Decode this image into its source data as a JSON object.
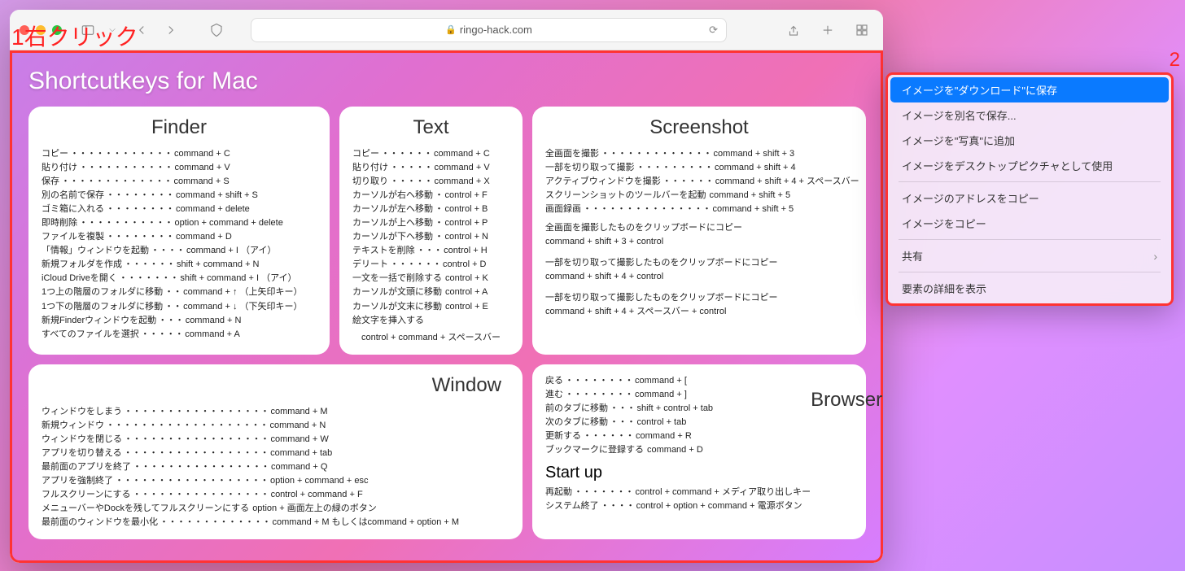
{
  "annotations": {
    "label1": "1右クリック",
    "label2": "2"
  },
  "browser": {
    "url_host": "ringo-hack.com"
  },
  "page": {
    "title": "Shortcutkeys for Mac"
  },
  "cards": {
    "finder": {
      "title": "Finder",
      "items": [
        {
          "label": "コピー",
          "dots": "・・・・・・・・・・・・",
          "key": "command + C"
        },
        {
          "label": "貼り付け",
          "dots": "・・・・・・・・・・・",
          "key": "command + V"
        },
        {
          "label": "保存",
          "dots": "・・・・・・・・・・・・・",
          "key": "command + S"
        },
        {
          "label": "別の名前で保存",
          "dots": "・・・・・・・・",
          "key": "command + shift + S"
        },
        {
          "label": "ゴミ箱に入れる",
          "dots": "・・・・・・・・",
          "key": "command + delete"
        },
        {
          "label": "即時削除",
          "dots": "・・・・・・・・・・・",
          "key": "option + command + delete"
        },
        {
          "label": "ファイルを複製",
          "dots": "・・・・・・・・",
          "key": "command + D"
        },
        {
          "label": "「情報」ウィンドウを起動",
          "dots": "・・・・",
          "key": "command + I （アイ）"
        },
        {
          "label": "新規フォルダを作成",
          "dots": "・・・・・・",
          "key": "shift + command + N"
        },
        {
          "label": "iCloud Driveを開く",
          "dots": "・・・・・・・",
          "key": "shift + command + I （アイ）"
        },
        {
          "label": "1つ上の階層のフォルダに移動",
          "dots": "・・",
          "key": "command + ↑ （上矢印キー）"
        },
        {
          "label": "1つ下の階層のフォルダに移動",
          "dots": "・・",
          "key": "command + ↓ （下矢印キー）"
        },
        {
          "label": "新規Finderウィンドウを起動",
          "dots": "・・・",
          "key": "command + N"
        },
        {
          "label": "すべてのファイルを選択",
          "dots": "・・・・・",
          "key": "command + A"
        }
      ]
    },
    "text": {
      "title": "Text",
      "items": [
        {
          "label": "コピー",
          "dots": "・・・・・・",
          "key": "command + C"
        },
        {
          "label": "貼り付け",
          "dots": "・・・・・",
          "key": "command + V"
        },
        {
          "label": "切り取り",
          "dots": "・・・・・",
          "key": "command + X"
        },
        {
          "label": "カーソルが右へ移動",
          "dots": "・",
          "key": "control + F"
        },
        {
          "label": "カーソルが左へ移動",
          "dots": "・",
          "key": "control + B"
        },
        {
          "label": "カーソルが上へ移動",
          "dots": "・",
          "key": "control + P"
        },
        {
          "label": "カーソルが下へ移動",
          "dots": "・",
          "key": "control + N"
        },
        {
          "label": "テキストを削除",
          "dots": "・・・",
          "key": "control + H"
        },
        {
          "label": "デリート",
          "dots": "・・・・・・",
          "key": "control + D"
        },
        {
          "label": "一文を一括で削除する",
          "dots": "",
          "key": "control + K"
        },
        {
          "label": "カーソルが文頭に移動",
          "dots": "",
          "key": "control + A"
        },
        {
          "label": "カーソルが文末に移動",
          "dots": "",
          "key": "control + E"
        },
        {
          "label": "絵文字を挿入する",
          "dots": "",
          "key": ""
        }
      ],
      "footer": "control + command + スペースバー"
    },
    "screenshot": {
      "title": "Screenshot",
      "items": [
        {
          "label": "全画面を撮影",
          "dots": "・・・・・・・・・・・・・",
          "key": "command + shift + 3"
        },
        {
          "label": "一部を切り取って撮影",
          "dots": "・・・・・・・・・",
          "key": "command + shift + 4"
        },
        {
          "label": "アクティブウィンドウを撮影",
          "dots": "・・・・・・",
          "key": "command + shift + 4 + スペースバー"
        },
        {
          "label": "スクリーンショットのツールバーを起動",
          "dots": "",
          "key": "command + shift + 5"
        },
        {
          "label": "画面録画",
          "dots": "・・・・・・・・・・・・・・・",
          "key": "command + shift + 5"
        }
      ],
      "notes": [
        "全画面を撮影したものをクリップボードにコピー",
        "command + shift + 3 + control",
        "一部を切り取って撮影したものをクリップボードにコピー",
        "command + shift + 4 + control",
        "一部を切り取って撮影したものをクリップボードにコピー",
        "command + shift + 4 + スペースバー + control"
      ]
    },
    "window": {
      "title": "Window",
      "items": [
        {
          "label": "ウィンドウをしまう",
          "dots": "・・・・・・・・・・・・・・・・・",
          "key": "command + M"
        },
        {
          "label": "新規ウィンドウ",
          "dots": "・・・・・・・・・・・・・・・・・・・",
          "key": "command + N"
        },
        {
          "label": "ウィンドウを閉じる",
          "dots": "・・・・・・・・・・・・・・・・・",
          "key": "command + W"
        },
        {
          "label": "アプリを切り替える",
          "dots": "・・・・・・・・・・・・・・・・・",
          "key": "command + tab"
        },
        {
          "label": "最前面のアプリを終了",
          "dots": "・・・・・・・・・・・・・・・・",
          "key": "command + Q"
        },
        {
          "label": "アプリを強制終了",
          "dots": "・・・・・・・・・・・・・・・・・・",
          "key": "option + command + esc"
        },
        {
          "label": "フルスクリーンにする",
          "dots": "・・・・・・・・・・・・・・・・",
          "key": "control + command + F"
        },
        {
          "label": "メニューバーやDockを残してフルスクリーンにする",
          "dots": "",
          "key": "option + 画面左上の緑のボタン"
        },
        {
          "label": "最前面のウィンドウを最小化",
          "dots": "・・・・・・・・・・・・・",
          "key": "command + M もしくはcommand + option + M"
        }
      ]
    },
    "browser": {
      "title": "Browser",
      "items": [
        {
          "label": "戻る",
          "dots": "・・・・・・・・",
          "key": "command + ["
        },
        {
          "label": "進む",
          "dots": "・・・・・・・・",
          "key": "command + ]"
        },
        {
          "label": "前のタブに移動",
          "dots": "・・・",
          "key": "shift + control + tab"
        },
        {
          "label": "次のタブに移動",
          "dots": "・・・",
          "key": "control + tab"
        },
        {
          "label": "更新する",
          "dots": "・・・・・・",
          "key": "command + R"
        },
        {
          "label": "ブックマークに登録する",
          "dots": "",
          "key": "command + D"
        }
      ]
    },
    "startup": {
      "title": "Start up",
      "items": [
        {
          "label": "再起動",
          "dots": "・・・・・・・",
          "key": "control + command + メディア取り出しキー"
        },
        {
          "label": "システム終了",
          "dots": "・・・・",
          "key": "control + option + command + 電源ボタン"
        }
      ]
    }
  },
  "context_menu": {
    "items": [
      {
        "label": "イメージを\"ダウンロード\"に保存",
        "selected": true
      },
      {
        "label": "イメージを別名で保存..."
      },
      {
        "label": "イメージを\"写真\"に追加"
      },
      {
        "label": "イメージをデスクトップピクチャとして使用"
      },
      {
        "divider": true
      },
      {
        "label": "イメージのアドレスをコピー"
      },
      {
        "label": "イメージをコピー"
      },
      {
        "divider": true
      },
      {
        "label": "共有",
        "arrow": true
      },
      {
        "divider": true
      },
      {
        "label": "要素の詳細を表示"
      }
    ]
  }
}
